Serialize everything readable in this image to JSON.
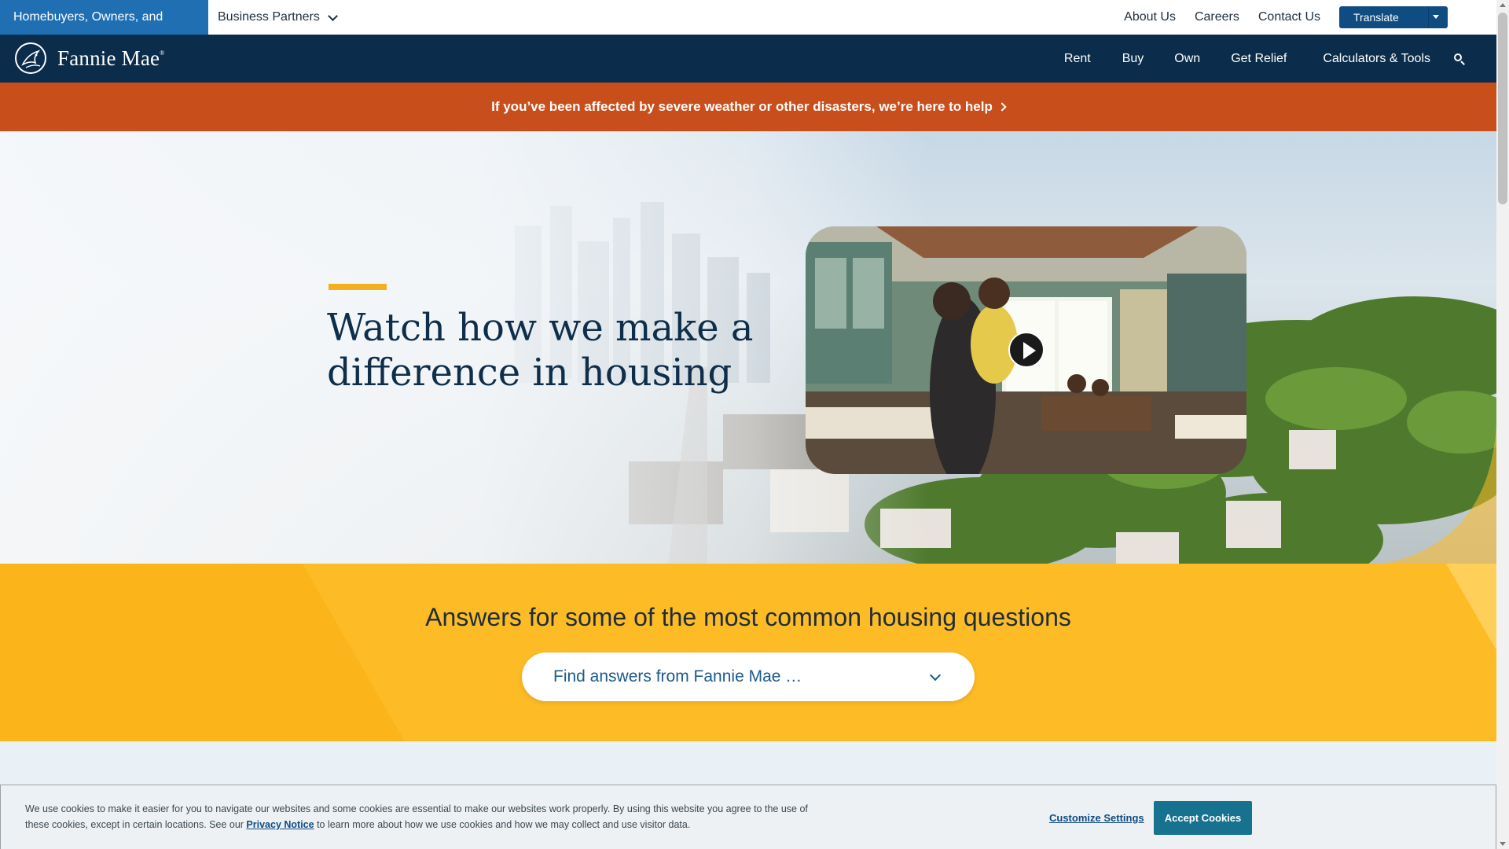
{
  "utility_bar": {
    "active_audience": "Homebuyers, Owners, and Renters",
    "business_partners": "Business Partners",
    "links": [
      "About Us",
      "Careers",
      "Contact Us"
    ],
    "translate_label": "Translate"
  },
  "main_nav": {
    "logo_text": "Fannie Mae",
    "items": [
      "Rent",
      "Buy",
      "Own",
      "Get Relief",
      "Calculators & Tools"
    ],
    "search_icon": "search-icon"
  },
  "alert": {
    "text": "If you’ve been affected by severe weather or other disasters, we’re here to help"
  },
  "hero": {
    "title": "Watch how we make a difference in housing",
    "video_play_icon": "play-icon"
  },
  "answers": {
    "title": "Answers for some of the most common housing questions",
    "select_placeholder": "Find answers from Fannie Mae …"
  },
  "cookie_banner": {
    "text_before_link": "We use cookies to make it easier for you to navigate our websites and some cookies are essential to make our websites work properly. By using this website you agree to the use of these cookies, except in certain locations. See our",
    "link_text": "Privacy Notice",
    "text_after_link": "to learn more about how we use cookies and how we may collect and use visitor data.",
    "customize_label": "Customize Settings",
    "accept_label": "Accept Cookies"
  },
  "colors": {
    "brand_blue": "#1f6fb2",
    "nav_navy": "#0b2c4a",
    "alert_orange": "#c84f1c",
    "answers_yellow": "#fdbc26",
    "accent_gold": "#f2b01e",
    "accept_teal": "#16728f"
  }
}
